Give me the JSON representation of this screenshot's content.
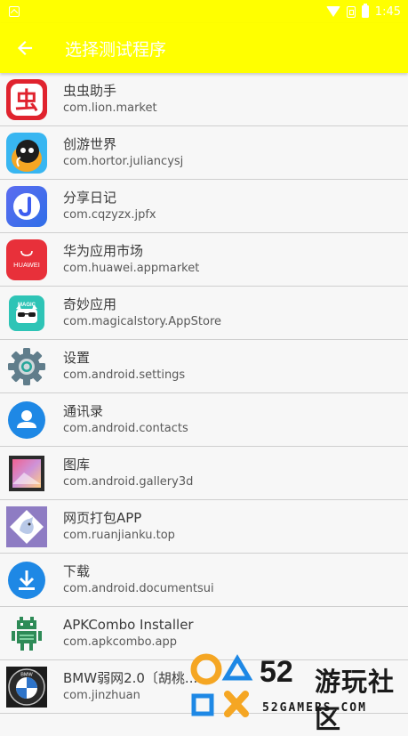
{
  "status_bar": {
    "time": "1:45"
  },
  "app_bar": {
    "title": "选择测试程序"
  },
  "apps": [
    {
      "name": "虫虫助手",
      "package": "com.lion.market",
      "icon": "chongchong-icon"
    },
    {
      "name": "创游世界",
      "package": "com.hortor.juliancysj",
      "icon": "chuangyou-icon"
    },
    {
      "name": "分享日记",
      "package": "com.cqzyzx.jpfx",
      "icon": "fenxiang-icon"
    },
    {
      "name": "华为应用市场",
      "package": "com.huawei.appmarket",
      "icon": "huawei-appmarket-icon"
    },
    {
      "name": "奇妙应用",
      "package": "com.magicalstory.AppStore",
      "icon": "magic-icon"
    },
    {
      "name": "设置",
      "package": "com.android.settings",
      "icon": "settings-gear-icon"
    },
    {
      "name": "通讯录",
      "package": "com.android.contacts",
      "icon": "contacts-icon"
    },
    {
      "name": "图库",
      "package": "com.android.gallery3d",
      "icon": "gallery-icon"
    },
    {
      "name": "网页打包APP",
      "package": "com.ruanjianku.top",
      "icon": "web-pack-icon"
    },
    {
      "name": "下载",
      "package": "com.android.documentsui",
      "icon": "download-icon"
    },
    {
      "name": "APKCombo Installer",
      "package": "com.apkcombo.app",
      "icon": "apkcombo-android-icon"
    },
    {
      "name": "BMW弱网2.0〔胡桃...",
      "package": "com.jinzhuan",
      "icon": "bmw-icon"
    }
  ],
  "icon_labels": {
    "huawei": "HUAWEI",
    "magic": "MAGIC",
    "bmw": "BMW",
    "chong": "虫"
  },
  "watermark": {
    "number": "52",
    "name": "游玩社区",
    "domain": "52GAMERS.COM"
  },
  "colors": {
    "app_bar": "#ffff00",
    "accent_blue": "#1e88e5",
    "huawei_red": "#e8303a"
  }
}
